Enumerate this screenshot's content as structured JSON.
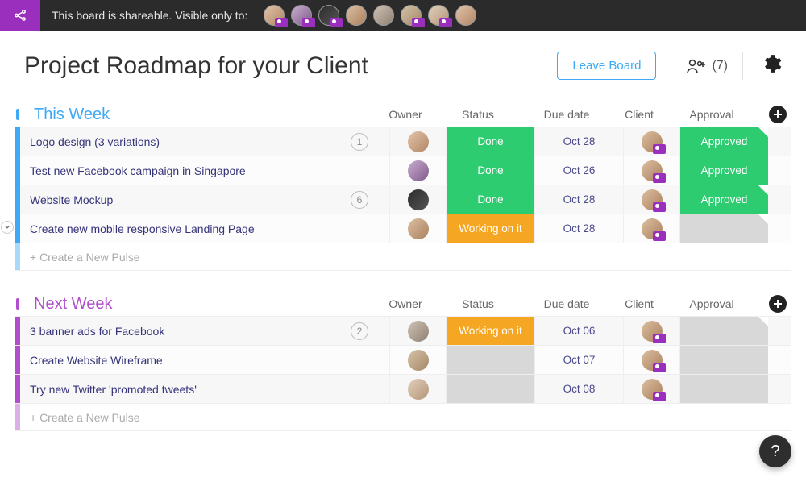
{
  "sharebar": {
    "text": "This board is shareable. Visible only to:",
    "avatars": [
      {
        "badge": true
      },
      {
        "badge": true
      },
      {
        "badge": true
      },
      {
        "badge": false
      },
      {
        "badge": false
      },
      {
        "badge": true
      },
      {
        "badge": true
      },
      {
        "badge": false
      }
    ]
  },
  "header": {
    "title": "Project Roadmap for your Client",
    "leave_label": "Leave Board",
    "member_count_label": "(7)"
  },
  "columns": {
    "owner": "Owner",
    "status": "Status",
    "due": "Due date",
    "client": "Client",
    "approval": "Approval"
  },
  "new_pulse_placeholder": "+ Create a New Pulse",
  "status_colors": {
    "Done": "#2ecc71",
    "Working on it": "#f5a623",
    "": "#d8d8d8",
    "Approved": "#2ecc71"
  },
  "groups": [
    {
      "title": "This Week",
      "color": "#3fa9f5",
      "rows": [
        {
          "name": "Logo design (3 variations)",
          "count": "1",
          "status": "Done",
          "due": "Oct 28",
          "approval": "Approved",
          "fold": true
        },
        {
          "name": "Test new Facebook campaign in Singapore",
          "count": "",
          "status": "Done",
          "due": "Oct 26",
          "approval": "Approved",
          "fold": false
        },
        {
          "name": "Website Mockup",
          "count": "6",
          "status": "Done",
          "due": "Oct 28",
          "approval": "Approved",
          "fold": true
        },
        {
          "name": "Create new mobile responsive Landing Page",
          "count": "",
          "status": "Working on it",
          "due": "Oct 28",
          "approval": "",
          "fold": true
        }
      ]
    },
    {
      "title": "Next Week",
      "color": "#b04ecb",
      "rows": [
        {
          "name": "3 banner ads for Facebook",
          "count": "2",
          "status": "Working on it",
          "due": "Oct 06",
          "approval": "",
          "fold": true
        },
        {
          "name": "Create Website Wireframe",
          "count": "",
          "status": "",
          "due": "Oct 07",
          "approval": "",
          "fold": false
        },
        {
          "name": "Try new Twitter 'promoted tweets'",
          "count": "",
          "status": "",
          "due": "Oct 08",
          "approval": "",
          "fold": false
        }
      ]
    }
  ],
  "help_label": "?"
}
